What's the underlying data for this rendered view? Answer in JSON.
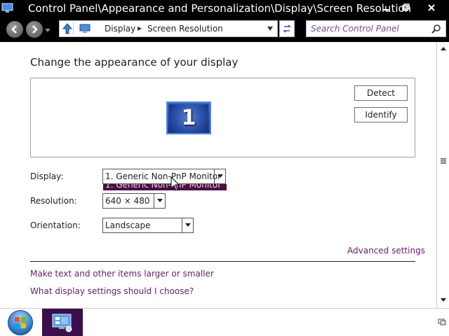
{
  "window": {
    "title": "Control Panel\\Appearance and Personalization\\Display\\Screen Resolution",
    "icon": "control-panel-icon",
    "controls": [
      "minimize-icon",
      "maximize-icon",
      "close-icon"
    ]
  },
  "address_bar": {
    "breadcrumbs": [
      "Display",
      "Screen Resolution"
    ],
    "search_placeholder": "Search Control Panel"
  },
  "main": {
    "heading": "Change the appearance of your display",
    "monitor_number": "1",
    "detect_label": "Detect",
    "identify_label": "Identify",
    "display_label": "Display:",
    "display_value": "1. Generic Non-PnP Monitor",
    "display_dropdown_option": "1. Generic Non-PnP Monitor",
    "resolution_label": "Resolution:",
    "resolution_value": "640 × 480",
    "orientation_label": "Orientation:",
    "orientation_value": "Landscape",
    "advanced_settings": "Advanced settings",
    "link_text_size": "Make text and other items larger or smaller",
    "link_help": "What display settings should I choose?"
  },
  "taskbar": {
    "items": [
      "start-orb-icon",
      "control-panel-task-icon"
    ]
  },
  "colors": {
    "accent_purple": "#3c0e4c",
    "link": "#6a1b6a",
    "monitor_blue": "#2a4faa"
  }
}
